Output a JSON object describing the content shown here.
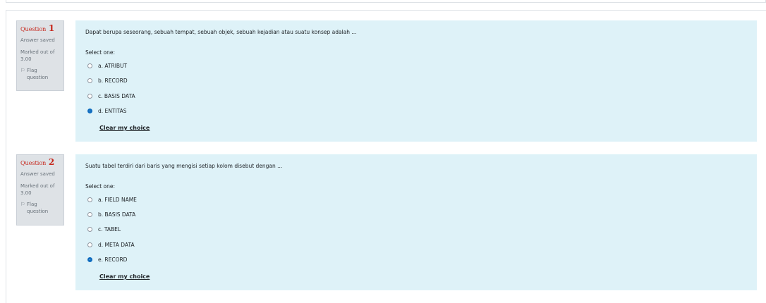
{
  "questions": [
    {
      "label": "Question",
      "number": "1",
      "state": "Answer saved",
      "grade_line1": "Marked out of",
      "grade_line2": "3.00",
      "flag_icon": "flag-icon",
      "flag_line1": "Flag",
      "flag_line2": "question",
      "text": "Dapat berupa seseorang, sebuah tempat, sebuah objek, sebuah kejadian atau suatu konsep adalah ...",
      "prompt": "Select one:",
      "options": [
        {
          "label": "a. ATRIBUT",
          "checked": false
        },
        {
          "label": "b. RECORD",
          "checked": false
        },
        {
          "label": "c. BASIS DATA",
          "checked": false
        },
        {
          "label": "d. ENTITAS",
          "checked": true
        }
      ],
      "clear_label": "Clear my choice"
    },
    {
      "label": "Question",
      "number": "2",
      "state": "Answer saved",
      "grade_line1": "Marked out of",
      "grade_line2": "3.00",
      "flag_icon": "flag-icon",
      "flag_line1": "Flag",
      "flag_line2": "question",
      "text": "Suatu tabel terdiri dari baris yang mengisi setiap kolom disebut dengan ...",
      "prompt": "Select one:",
      "options": [
        {
          "label": "a. FIELD NAME",
          "checked": false
        },
        {
          "label": "b. BASIS DATA",
          "checked": false
        },
        {
          "label": "c. TABEL",
          "checked": false
        },
        {
          "label": "d. META DATA",
          "checked": false
        },
        {
          "label": "e. RECORD",
          "checked": true
        }
      ],
      "clear_label": "Clear my choice"
    }
  ],
  "colors": {
    "question_number": "#c6271c",
    "info_background": "#dee2e6",
    "formulation_background": "#def2f8",
    "radio_checked": "#0f6cbf"
  }
}
